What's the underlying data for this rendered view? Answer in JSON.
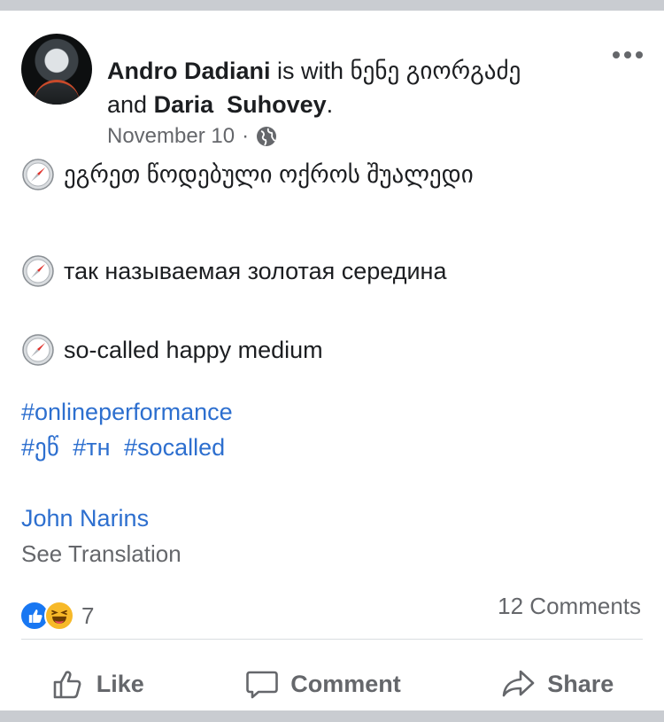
{
  "post": {
    "author": "Andro Dadiani",
    "with_text": "is with",
    "tagged1": "ნენე გიორგაძე",
    "and_text": "and",
    "tagged2": "Daria  Suhovey",
    "period": ".",
    "date": "November 10",
    "separator": "·",
    "lines": [
      "ეგრეთ წოდებული ოქროს შუალედი",
      "так называемая золотая середина",
      "so-called happy medium"
    ],
    "hashtags_row1": [
      "#onlineperformance"
    ],
    "hashtags_row2": [
      "#ეწ",
      "#тн",
      "#socalled"
    ],
    "mention": "John Narins",
    "see_translation": "See Translation"
  },
  "reactions": {
    "count": "7",
    "icons": [
      "like-reaction-icon",
      "haha-reaction-icon"
    ]
  },
  "comments_label": "12 Comments",
  "actions": {
    "like": "Like",
    "comment": "Comment",
    "share": "Share"
  },
  "colors": {
    "link": "#2d6fcf",
    "muted": "#65676b",
    "background": "#c9ccd1"
  }
}
